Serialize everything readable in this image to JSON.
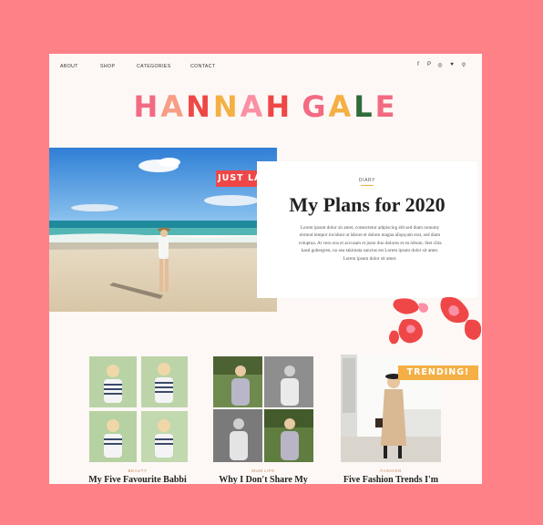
{
  "nav": {
    "items": [
      {
        "label": "ABOUT"
      },
      {
        "label": "SHOP"
      },
      {
        "label": "CATEGORIES"
      },
      {
        "label": "CONTACT"
      }
    ],
    "social": [
      "f",
      "P",
      "◎",
      "♥",
      "⚲"
    ]
  },
  "logo": {
    "letters": [
      {
        "char": "H",
        "color": "#f36a82"
      },
      {
        "char": "A",
        "color": "#f79d86"
      },
      {
        "char": "N",
        "color": "#ef4747"
      },
      {
        "char": "N",
        "color": "#f4b045"
      },
      {
        "char": "A",
        "color": "#fb8fa4"
      },
      {
        "char": "H",
        "color": "#ef4747"
      },
      {
        "char": " ",
        "color": "#000000"
      },
      {
        "char": "G",
        "color": "#f36a82"
      },
      {
        "char": "A",
        "color": "#f4b045"
      },
      {
        "char": "L",
        "color": "#2f6b3d"
      },
      {
        "char": "E",
        "color": "#f36a82"
      }
    ]
  },
  "hero": {
    "badge": "JUST LANDED!"
  },
  "feature": {
    "category": "DIARY",
    "title": "My Plans for 2020",
    "excerpt": "Lorem ipsum dolor sit amet, consectetur adipiscing elit sed diam nonumy eirmod tempor invidunt ut labore et dolore magna aliquyam erat, sed diam voluptua. At vero eos et accusam et justo duo dolores et ea rebum. Stet clita kasd gubergren, no sea takimata sanctus est Lorem ipsum dolor sit amet. Lorem ipsum dolor sit amet."
  },
  "posts": [
    {
      "category": "BEAUTY",
      "title": "My Five Favourite Babbi"
    },
    {
      "category": "MUM LIFE",
      "title": "Why I Don't Share My"
    },
    {
      "category": "FASHION",
      "title": "Five Fashion Trends I'm"
    }
  ],
  "trending_badge": "TRENDING!",
  "colors": {
    "background": "#fe8187",
    "page": "#fdf8f5",
    "red": "#ef4747",
    "orange": "#f4b045"
  }
}
